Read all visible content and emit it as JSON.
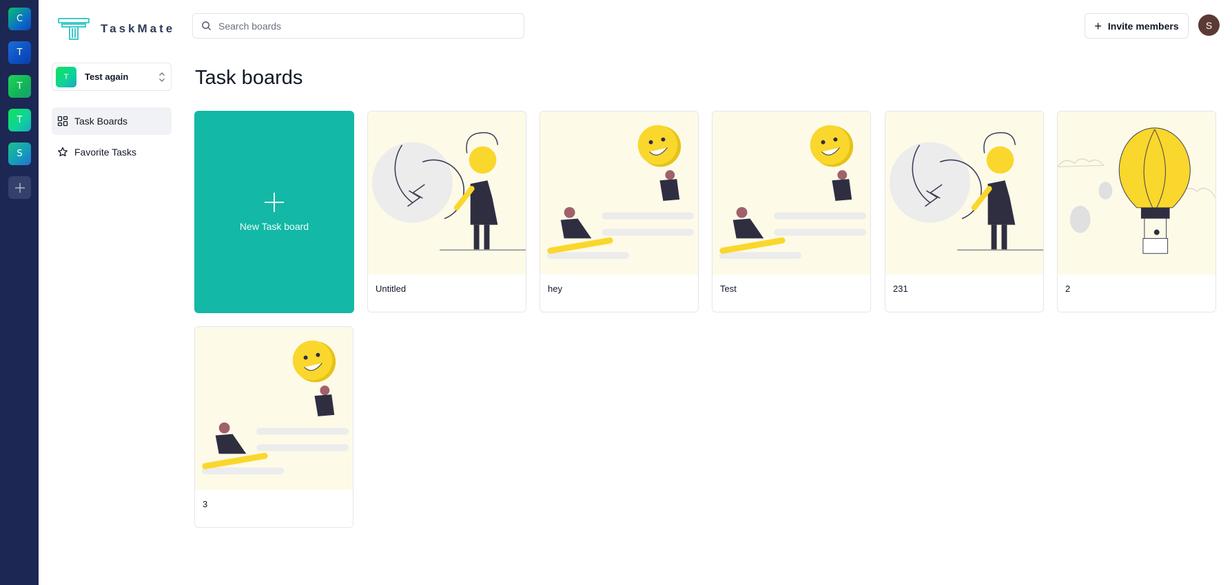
{
  "org_rail": {
    "orgs": [
      {
        "initial": "C"
      },
      {
        "initial": "T"
      },
      {
        "initial": "T"
      },
      {
        "initial": "T"
      },
      {
        "initial": "S"
      }
    ],
    "add_icon": "plus-icon"
  },
  "sidebar": {
    "app_name": "TaskMate",
    "current_org": {
      "initial": "T",
      "name": "Test again"
    },
    "nav": [
      {
        "label": "Task Boards",
        "icon": "grid-icon",
        "active": true
      },
      {
        "label": "Favorite Tasks",
        "icon": "star-icon",
        "active": false
      }
    ]
  },
  "header": {
    "search_placeholder": "Search boards",
    "invite_label": "Invite members",
    "user_initial": "S"
  },
  "main": {
    "title": "Task boards",
    "new_board_label": "New Task board",
    "boards": [
      {
        "title": "Untitled",
        "illustration": "circle-arrows"
      },
      {
        "title": "hey",
        "illustration": "smiley-balloon"
      },
      {
        "title": "Test",
        "illustration": "smiley-balloon"
      },
      {
        "title": "231",
        "illustration": "circle-arrows"
      },
      {
        "title": "2",
        "illustration": "hot-air-balloon"
      },
      {
        "title": "3",
        "illustration": "smiley-balloon"
      }
    ]
  },
  "colors": {
    "rail_bg": "#1c2754",
    "accent_teal": "#14b8a6",
    "thumb_bg": "#fdfae8",
    "illustration_yellow": "#fad72c"
  }
}
